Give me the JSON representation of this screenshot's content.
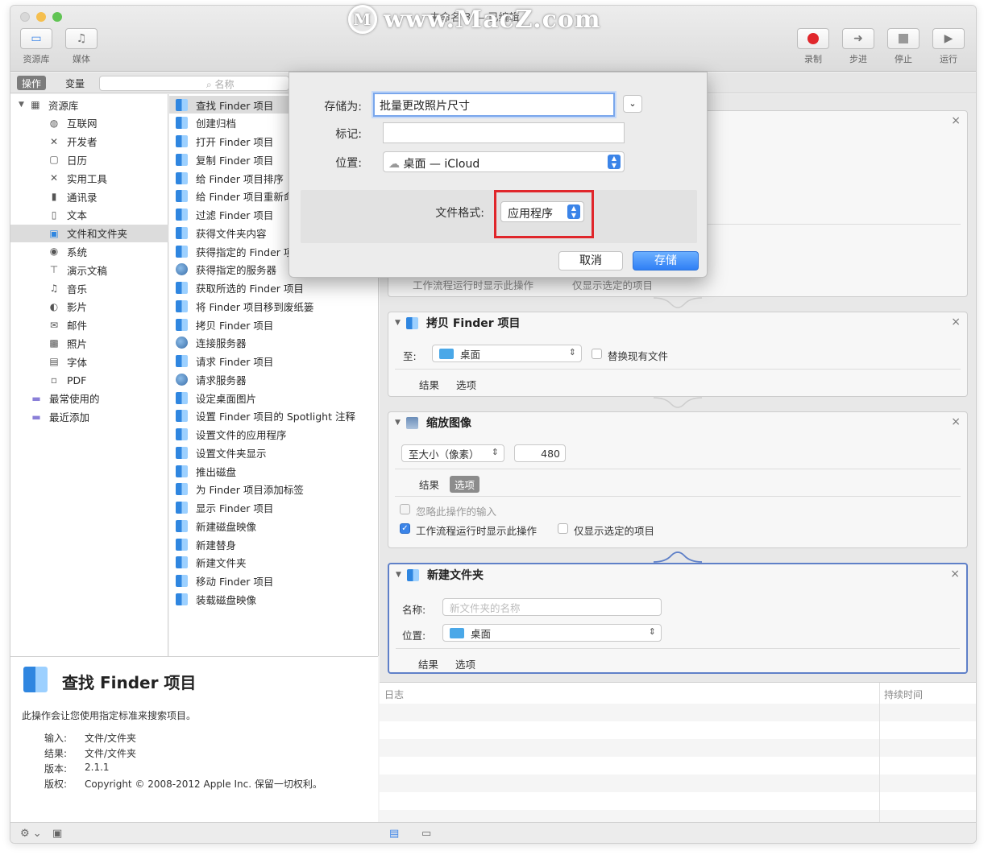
{
  "watermark": "www.MacZ.com",
  "window": {
    "title": "未命名 3 — 已编辑"
  },
  "toolbar": {
    "left": [
      {
        "label": "资源库",
        "icon": "library-icon"
      },
      {
        "label": "媒体",
        "icon": "media-icon"
      }
    ],
    "right": [
      {
        "label": "录制",
        "icon": "record-icon"
      },
      {
        "label": "步进",
        "icon": "step-icon"
      },
      {
        "label": "停止",
        "icon": "stop-icon"
      },
      {
        "label": "运行",
        "icon": "run-icon"
      }
    ]
  },
  "library_bar": {
    "actions_tab": "操作",
    "variables_tab": "变量",
    "search_placeholder": "名称"
  },
  "categories": [
    {
      "label": "资源库",
      "icon": "library-icon",
      "expanded": true
    },
    {
      "label": "互联网",
      "icon": "globe-icon"
    },
    {
      "label": "开发者",
      "icon": "tools-icon"
    },
    {
      "label": "日历",
      "icon": "calendar-icon"
    },
    {
      "label": "实用工具",
      "icon": "tools-icon"
    },
    {
      "label": "通讯录",
      "icon": "contacts-icon"
    },
    {
      "label": "文本",
      "icon": "text-icon"
    },
    {
      "label": "文件和文件夹",
      "icon": "finder-icon",
      "selected": true
    },
    {
      "label": "系统",
      "icon": "system-icon"
    },
    {
      "label": "演示文稿",
      "icon": "presentation-icon"
    },
    {
      "label": "音乐",
      "icon": "music-icon"
    },
    {
      "label": "影片",
      "icon": "movie-icon"
    },
    {
      "label": "邮件",
      "icon": "mail-icon"
    },
    {
      "label": "照片",
      "icon": "photo-icon"
    },
    {
      "label": "字体",
      "icon": "font-icon"
    },
    {
      "label": "PDF",
      "icon": "pdf-icon"
    },
    {
      "label": "最常使用的",
      "icon": "folder-icon"
    },
    {
      "label": "最近添加",
      "icon": "folder-icon"
    }
  ],
  "actions": [
    {
      "label": "查找 Finder 项目",
      "icon": "finder",
      "selected": true
    },
    {
      "label": "创建归档",
      "icon": "finder"
    },
    {
      "label": "打开 Finder 项目",
      "icon": "finder"
    },
    {
      "label": "复制 Finder 项目",
      "icon": "finder"
    },
    {
      "label": "给 Finder 项目排序",
      "icon": "finder"
    },
    {
      "label": "给 Finder 项目重新命名",
      "icon": "finder"
    },
    {
      "label": "过滤 Finder 项目",
      "icon": "finder"
    },
    {
      "label": "获得文件夹内容",
      "icon": "finder"
    },
    {
      "label": "获得指定的 Finder 项目",
      "icon": "finder"
    },
    {
      "label": "获得指定的服务器",
      "icon": "globe"
    },
    {
      "label": "获取所选的 Finder 项目",
      "icon": "finder"
    },
    {
      "label": "将 Finder 项目移到废纸篓",
      "icon": "finder"
    },
    {
      "label": "拷贝 Finder 项目",
      "icon": "finder"
    },
    {
      "label": "连接服务器",
      "icon": "globe"
    },
    {
      "label": "请求 Finder 项目",
      "icon": "finder"
    },
    {
      "label": "请求服务器",
      "icon": "globe"
    },
    {
      "label": "设定桌面图片",
      "icon": "finder"
    },
    {
      "label": "设置 Finder 项目的 Spotlight 注释",
      "icon": "finder"
    },
    {
      "label": "设置文件的应用程序",
      "icon": "finder"
    },
    {
      "label": "设置文件夹显示",
      "icon": "finder"
    },
    {
      "label": "推出磁盘",
      "icon": "finder"
    },
    {
      "label": "为 Finder 项目添加标签",
      "icon": "finder"
    },
    {
      "label": "显示 Finder 项目",
      "icon": "finder"
    },
    {
      "label": "新建磁盘映像",
      "icon": "finder"
    },
    {
      "label": "新建替身",
      "icon": "finder"
    },
    {
      "label": "新建文件夹",
      "icon": "finder"
    },
    {
      "label": "移动 Finder 项目",
      "icon": "finder"
    },
    {
      "label": "装载磁盘映像",
      "icon": "finder"
    }
  ],
  "description": {
    "title": "查找 Finder 项目",
    "text": "此操作会让您使用指定标准来搜索项目。",
    "meta": [
      {
        "k": "输入:",
        "v": "文件/文件夹"
      },
      {
        "k": "结果:",
        "v": "文件/文件夹"
      },
      {
        "k": "版本:",
        "v": "2.1.1"
      },
      {
        "k": "版权:",
        "v": "Copyright © 2008-2012 Apple Inc. 保留一切权利。"
      }
    ]
  },
  "workflow": {
    "partial_card": {
      "opt_show": "工作流程运行时显示此操作",
      "opt_selected": "仅显示选定的项目"
    },
    "copy_card": {
      "title": "拷贝 Finder 项目",
      "to_label": "至:",
      "to_value": "桌面",
      "replace_label": "替换现有文件",
      "tab_results": "结果",
      "tab_options": "选项"
    },
    "scale_card": {
      "title": "缩放图像",
      "mode": "至大小（像素）",
      "size": "480",
      "tab_results": "结果",
      "tab_options": "选项",
      "ignore_input": "忽略此操作的输入",
      "show_when_run": "工作流程运行时显示此操作",
      "show_selected": "仅显示选定的项目"
    },
    "newfolder_card": {
      "title": "新建文件夹",
      "name_label": "名称:",
      "name_placeholder": "新文件夹的名称",
      "loc_label": "位置:",
      "loc_value": "桌面",
      "tab_results": "结果",
      "tab_options": "选项"
    }
  },
  "log": {
    "col_log": "日志",
    "col_duration": "持续时间"
  },
  "save_dialog": {
    "save_as_label": "存储为:",
    "save_as_value": "批量更改照片尺寸",
    "tags_label": "标记:",
    "where_label": "位置:",
    "where_value": "桌面 — iCloud",
    "format_label": "文件格式:",
    "format_value": "应用程序",
    "cancel": "取消",
    "save": "存储"
  },
  "colors": {
    "highlight": "#e0262b",
    "accent": "#3b84e8"
  }
}
